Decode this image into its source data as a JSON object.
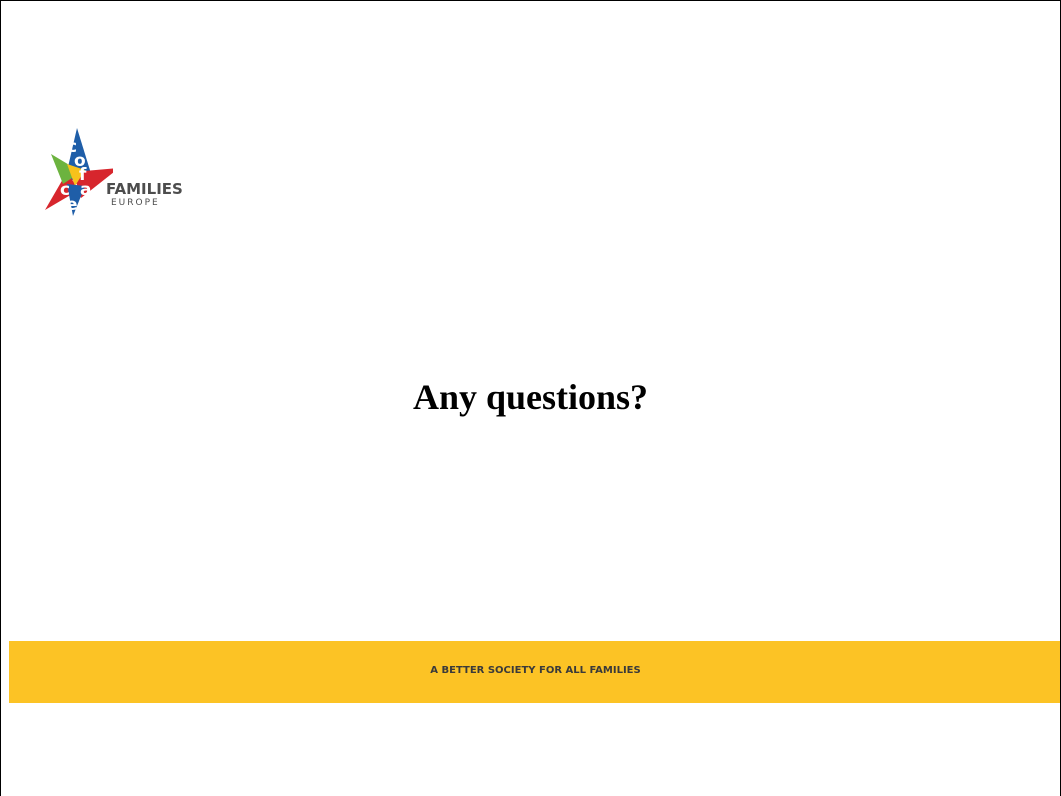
{
  "logo": {
    "letters": [
      "c",
      "o",
      "f",
      "a",
      "c",
      "e"
    ],
    "name": "FAMILIES",
    "sub": "EUROPE",
    "colors": {
      "blue": "#1f5ea8",
      "green": "#6cb33f",
      "red": "#d7262d",
      "yellow": "#f7c21b",
      "gray": "#4d4d4d"
    }
  },
  "slide": {
    "heading": "Any questions?",
    "tagline": "A BETTER SOCIETY FOR ALL FAMILIES",
    "band_color": "#fcc325"
  }
}
